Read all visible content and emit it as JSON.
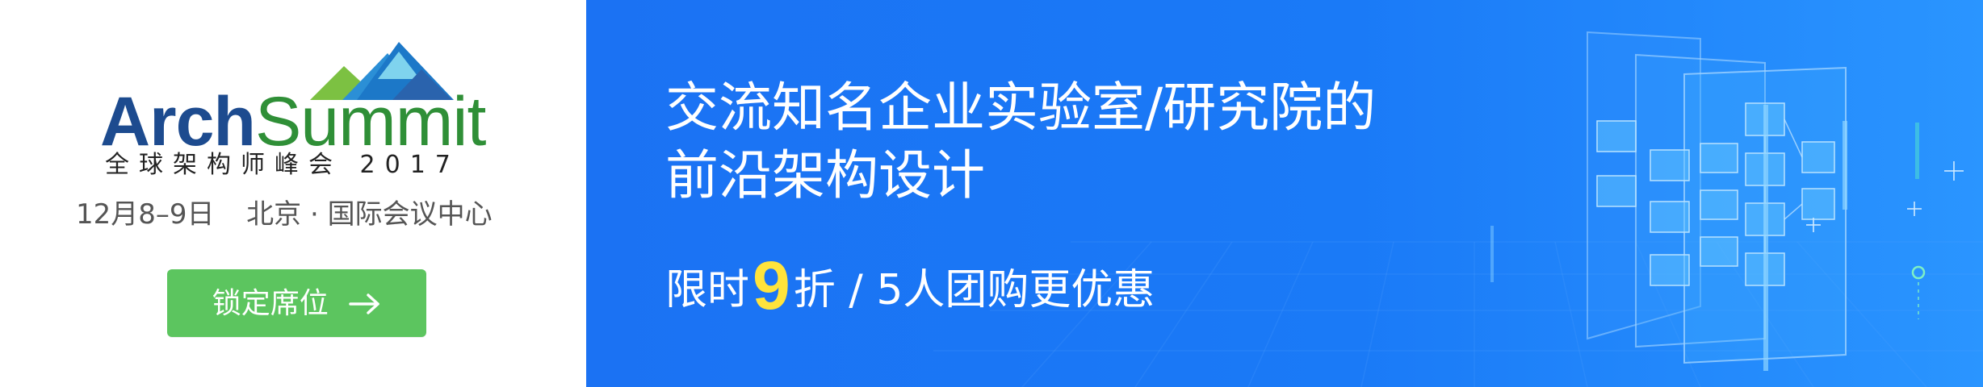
{
  "brand": {
    "name_part1": "Arch",
    "name_part2": "Summit",
    "subtitle": "全球架构师峰会 2017",
    "colors": {
      "arch": "#1d4b8f",
      "summit": "#2f8f37",
      "mountain_blue": "#2b8fd6",
      "mountain_green": "#7cc142"
    }
  },
  "event": {
    "date": "12月8–9日",
    "location": "北京 · 国际会议中心"
  },
  "cta": {
    "label": "锁定席位",
    "icon": "arrow-right-icon",
    "color": "#5cc55f"
  },
  "headline": {
    "line1": "交流知名企业实验室/研究院的",
    "line2": "前沿架构设计"
  },
  "promo": {
    "prefix": "限时",
    "number": "9",
    "suffix": "折 / 5人团购更优惠",
    "number_color": "#ffe33b"
  },
  "theme": {
    "panel_blue": "#1b72f3",
    "text_white": "#ffffff"
  }
}
